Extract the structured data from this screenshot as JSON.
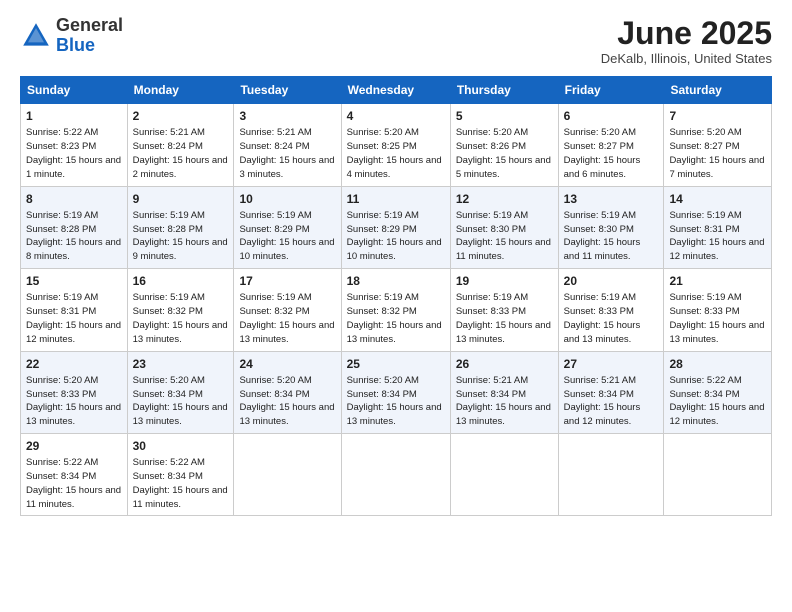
{
  "logo": {
    "general": "General",
    "blue": "Blue"
  },
  "title": "June 2025",
  "location": "DeKalb, Illinois, United States",
  "days_of_week": [
    "Sunday",
    "Monday",
    "Tuesday",
    "Wednesday",
    "Thursday",
    "Friday",
    "Saturday"
  ],
  "weeks": [
    [
      {
        "num": "1",
        "sunrise": "5:22 AM",
        "sunset": "8:23 PM",
        "daylight": "15 hours and 1 minute."
      },
      {
        "num": "2",
        "sunrise": "5:21 AM",
        "sunset": "8:24 PM",
        "daylight": "15 hours and 2 minutes."
      },
      {
        "num": "3",
        "sunrise": "5:21 AM",
        "sunset": "8:24 PM",
        "daylight": "15 hours and 3 minutes."
      },
      {
        "num": "4",
        "sunrise": "5:20 AM",
        "sunset": "8:25 PM",
        "daylight": "15 hours and 4 minutes."
      },
      {
        "num": "5",
        "sunrise": "5:20 AM",
        "sunset": "8:26 PM",
        "daylight": "15 hours and 5 minutes."
      },
      {
        "num": "6",
        "sunrise": "5:20 AM",
        "sunset": "8:27 PM",
        "daylight": "15 hours and 6 minutes."
      },
      {
        "num": "7",
        "sunrise": "5:20 AM",
        "sunset": "8:27 PM",
        "daylight": "15 hours and 7 minutes."
      }
    ],
    [
      {
        "num": "8",
        "sunrise": "5:19 AM",
        "sunset": "8:28 PM",
        "daylight": "15 hours and 8 minutes."
      },
      {
        "num": "9",
        "sunrise": "5:19 AM",
        "sunset": "8:28 PM",
        "daylight": "15 hours and 9 minutes."
      },
      {
        "num": "10",
        "sunrise": "5:19 AM",
        "sunset": "8:29 PM",
        "daylight": "15 hours and 10 minutes."
      },
      {
        "num": "11",
        "sunrise": "5:19 AM",
        "sunset": "8:29 PM",
        "daylight": "15 hours and 10 minutes."
      },
      {
        "num": "12",
        "sunrise": "5:19 AM",
        "sunset": "8:30 PM",
        "daylight": "15 hours and 11 minutes."
      },
      {
        "num": "13",
        "sunrise": "5:19 AM",
        "sunset": "8:30 PM",
        "daylight": "15 hours and 11 minutes."
      },
      {
        "num": "14",
        "sunrise": "5:19 AM",
        "sunset": "8:31 PM",
        "daylight": "15 hours and 12 minutes."
      }
    ],
    [
      {
        "num": "15",
        "sunrise": "5:19 AM",
        "sunset": "8:31 PM",
        "daylight": "15 hours and 12 minutes."
      },
      {
        "num": "16",
        "sunrise": "5:19 AM",
        "sunset": "8:32 PM",
        "daylight": "15 hours and 13 minutes."
      },
      {
        "num": "17",
        "sunrise": "5:19 AM",
        "sunset": "8:32 PM",
        "daylight": "15 hours and 13 minutes."
      },
      {
        "num": "18",
        "sunrise": "5:19 AM",
        "sunset": "8:32 PM",
        "daylight": "15 hours and 13 minutes."
      },
      {
        "num": "19",
        "sunrise": "5:19 AM",
        "sunset": "8:33 PM",
        "daylight": "15 hours and 13 minutes."
      },
      {
        "num": "20",
        "sunrise": "5:19 AM",
        "sunset": "8:33 PM",
        "daylight": "15 hours and 13 minutes."
      },
      {
        "num": "21",
        "sunrise": "5:19 AM",
        "sunset": "8:33 PM",
        "daylight": "15 hours and 13 minutes."
      }
    ],
    [
      {
        "num": "22",
        "sunrise": "5:20 AM",
        "sunset": "8:33 PM",
        "daylight": "15 hours and 13 minutes."
      },
      {
        "num": "23",
        "sunrise": "5:20 AM",
        "sunset": "8:34 PM",
        "daylight": "15 hours and 13 minutes."
      },
      {
        "num": "24",
        "sunrise": "5:20 AM",
        "sunset": "8:34 PM",
        "daylight": "15 hours and 13 minutes."
      },
      {
        "num": "25",
        "sunrise": "5:20 AM",
        "sunset": "8:34 PM",
        "daylight": "15 hours and 13 minutes."
      },
      {
        "num": "26",
        "sunrise": "5:21 AM",
        "sunset": "8:34 PM",
        "daylight": "15 hours and 13 minutes."
      },
      {
        "num": "27",
        "sunrise": "5:21 AM",
        "sunset": "8:34 PM",
        "daylight": "15 hours and 12 minutes."
      },
      {
        "num": "28",
        "sunrise": "5:22 AM",
        "sunset": "8:34 PM",
        "daylight": "15 hours and 12 minutes."
      }
    ],
    [
      {
        "num": "29",
        "sunrise": "5:22 AM",
        "sunset": "8:34 PM",
        "daylight": "15 hours and 11 minutes."
      },
      {
        "num": "30",
        "sunrise": "5:22 AM",
        "sunset": "8:34 PM",
        "daylight": "15 hours and 11 minutes."
      },
      null,
      null,
      null,
      null,
      null
    ]
  ]
}
